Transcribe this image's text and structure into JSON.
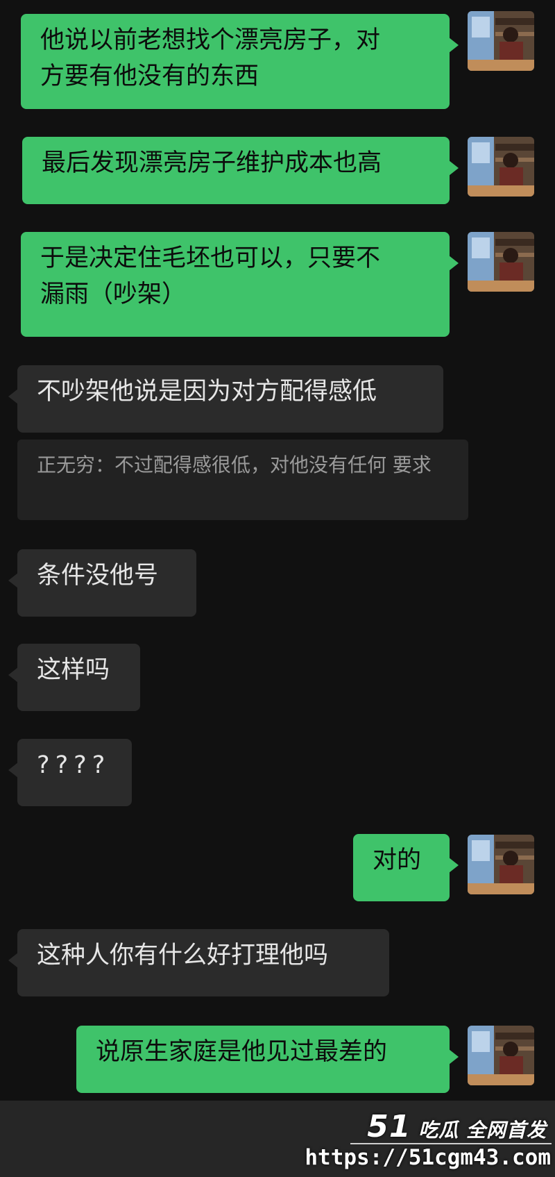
{
  "messages": [
    {
      "side": "sent",
      "text": "他说以前老想找个漂亮房子，对\n方要有他没有的东西"
    },
    {
      "side": "sent",
      "text": "最后发现漂亮房子维护成本也高"
    },
    {
      "side": "sent",
      "text": "于是决定住毛坯也可以，只要不\n漏雨（吵架）"
    },
    {
      "side": "recv",
      "text": "不吵架他说是因为对方配得感低"
    },
    {
      "side": "quote",
      "text": "正无穷：不过配得感很低，对他没有任何\n要求"
    },
    {
      "side": "recv",
      "text": "条件没他号"
    },
    {
      "side": "recv",
      "text": "这样吗"
    },
    {
      "side": "recv",
      "text": "????"
    },
    {
      "side": "sent",
      "text": "对的"
    },
    {
      "side": "recv",
      "text": "这种人你有什么好打理他吗"
    },
    {
      "side": "sent",
      "text": "说原生家庭是他见过最差的"
    }
  ],
  "watermark": {
    "logo_num": "51",
    "logo_text": "吃瓜 全网首发",
    "url": "https://51cgm43.com"
  },
  "colors": {
    "sent_bubble": "#3fc36a",
    "recv_bubble": "#2b2b2b",
    "background": "#111111"
  },
  "icons": {
    "avatar": "user-avatar-photo"
  }
}
